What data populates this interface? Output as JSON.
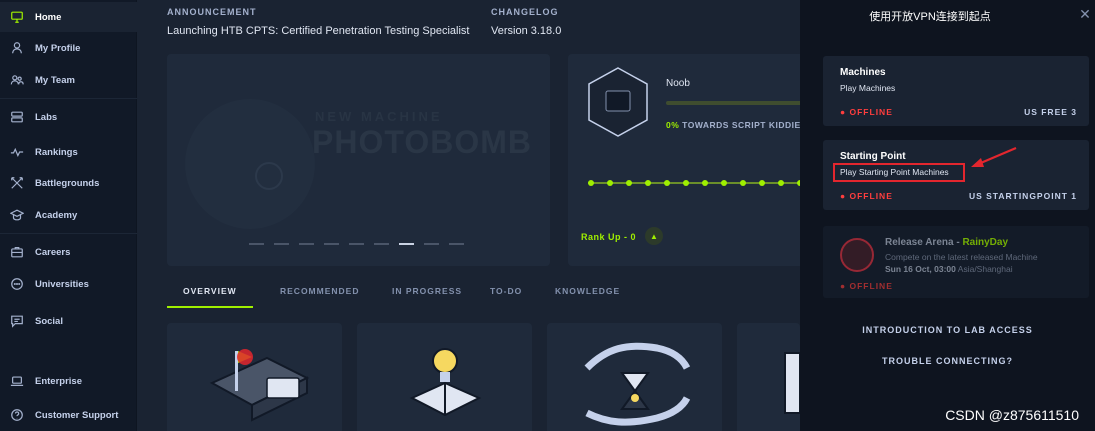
{
  "sidebar": {
    "items": [
      {
        "label": "Home",
        "icon": "monitor-icon"
      },
      {
        "label": "My Profile",
        "icon": "user-icon"
      },
      {
        "label": "My Team",
        "icon": "team-icon"
      },
      {
        "label": "Labs",
        "icon": "server-icon"
      },
      {
        "label": "Rankings",
        "icon": "trend-icon"
      },
      {
        "label": "Battlegrounds",
        "icon": "swords-icon"
      },
      {
        "label": "Academy",
        "icon": "graduation-cap-icon"
      },
      {
        "label": "Careers",
        "icon": "briefcase-icon"
      },
      {
        "label": "Universities",
        "icon": "university-icon"
      },
      {
        "label": "Social",
        "icon": "chat-icon"
      },
      {
        "label": "Enterprise",
        "icon": "laptop-icon"
      },
      {
        "label": "Customer Support",
        "icon": "help-icon"
      }
    ]
  },
  "header": {
    "announcement_label": "ANNOUNCEMENT",
    "announcement_text": "Launching HTB CPTS: Certified Penetration Testing Specialist",
    "changelog_label": "CHANGELOG",
    "changelog_text": "Version 3.18.0"
  },
  "banner": {
    "kicker": "NEW MACHINE",
    "machine": "PHOTOBOMB",
    "slides_total": 9,
    "slide_active": 7
  },
  "rank": {
    "name": "Noob",
    "progress_pct": 0,
    "progress_value": "0%",
    "progress_text": "TOWARDS SCRIPT KIDDIE",
    "rank_up": "Rank Up - 0",
    "rank_up_icon": "chevron-up-icon"
  },
  "tabs": [
    "OVERVIEW",
    "RECOMMENDED",
    "IN PROGRESS",
    "TO-DO",
    "KNOWLEDGE"
  ],
  "panel": {
    "title": "使用开放VPN连接到起点",
    "close_icon": "close-icon",
    "machines": {
      "title": "Machines",
      "subtitle": "Play Machines",
      "status": "OFFLINE",
      "server": "US FREE 3"
    },
    "starting_point": {
      "title": "Starting Point",
      "subtitle": "Play Starting Point Machines",
      "status": "OFFLINE",
      "server": "US STARTINGPOINT 1"
    },
    "arena": {
      "title": "Release Arena - ",
      "title_highlight": "RainyDay",
      "description": "Compete on the latest released Machine",
      "when": "Sun 16 Oct, 03:00",
      "timezone": "Asia/Shanghai",
      "status": "OFFLINE"
    },
    "link_intro": "INTRODUCTION TO LAB ACCESS",
    "link_trouble": "TROUBLE CONNECTING?"
  },
  "watermark": "CSDN @z875611510",
  "colors": {
    "accent": "#9fef00",
    "offline": "#ff3e3e",
    "highlight_box": "#e3262e"
  }
}
